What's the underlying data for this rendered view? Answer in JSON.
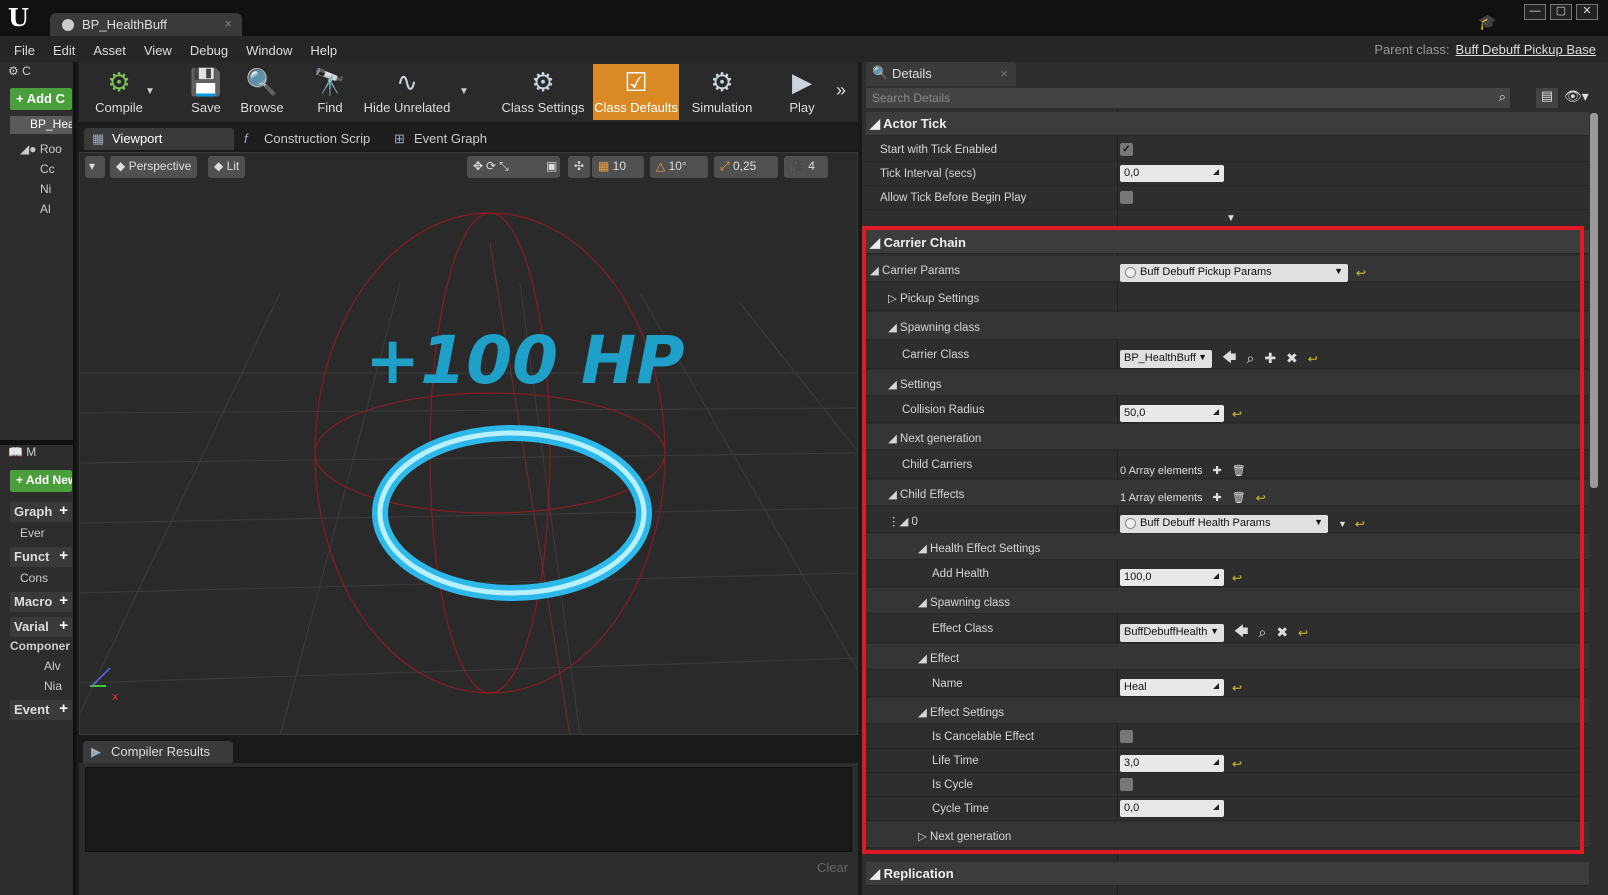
{
  "window": {
    "doc_tab": "BP_HealthBuff",
    "parent_class_label": "Parent class:",
    "parent_class_value": "Buff Debuff Pickup Base"
  },
  "menu": [
    "File",
    "Edit",
    "Asset",
    "View",
    "Debug",
    "Window",
    "Help"
  ],
  "left_panel": {
    "components_tab": "C",
    "add_component": "+ Add C",
    "root_item": "BP_Hea",
    "tree": [
      "Roo",
      "Cc",
      "Ni",
      "Al"
    ],
    "my_blueprint_tab": "M",
    "add_new": "+ Add New",
    "sections": [
      "Graph",
      "Funct",
      "Macro",
      "Varial",
      "Componer",
      "Event"
    ],
    "items": [
      "Ever",
      "Cons",
      "Alv",
      "Nia"
    ]
  },
  "toolbar": {
    "compile": "Compile",
    "save": "Save",
    "browse": "Browse",
    "find": "Find",
    "hide_unrelated": "Hide Unrelated",
    "class_settings": "Class Settings",
    "class_defaults": "Class Defaults",
    "simulation": "Simulation",
    "play": "Play"
  },
  "tabs": {
    "viewport": "Viewport",
    "construction": "Construction Scrip",
    "event_graph": "Event Graph"
  },
  "viewport": {
    "perspective": "Perspective",
    "lit": "Lit",
    "grid_snap": "10",
    "rot_snap": "10°",
    "scale_snap": "0,25",
    "cam_speed": "4",
    "hp_text": "+100 HP"
  },
  "compiler": {
    "tab": "Compiler Results",
    "clear": "Clear"
  },
  "details": {
    "tab": "Details",
    "search_placeholder": "Search Details",
    "actor_tick": "Actor Tick",
    "start_tick": "Start with Tick Enabled",
    "tick_interval": "Tick Interval (secs)",
    "tick_interval_val": "0,0",
    "allow_tick": "Allow Tick Before Begin Play",
    "carrier_chain": "Carrier Chain",
    "carrier_params": "Carrier Params",
    "carrier_params_val": "Buff Debuff Pickup Params",
    "pickup_settings": "Pickup Settings",
    "spawning_class": "Spawning class",
    "carrier_class": "Carrier Class",
    "carrier_class_val": "BP_HealthBuff",
    "settings": "Settings",
    "collision_radius": "Collision Radius",
    "collision_radius_val": "50,0",
    "next_gen": "Next generation",
    "child_carriers": "Child Carriers",
    "child_carriers_val": "0 Array elements",
    "child_effects": "Child Effects",
    "child_effects_val": "1 Array elements",
    "index0": "0",
    "index0_val": "Buff Debuff Health Params",
    "health_effect_settings": "Health Effect Settings",
    "add_health": "Add Health",
    "add_health_val": "100,0",
    "spawning_class2": "Spawning class",
    "effect_class": "Effect Class",
    "effect_class_val": "BuffDebuffHealth",
    "effect": "Effect",
    "name": "Name",
    "name_val": "Heal",
    "effect_settings": "Effect Settings",
    "is_cancelable": "Is Cancelable Effect",
    "life_time": "Life Time",
    "life_time_val": "3,0",
    "is_cycle": "Is Cycle",
    "cycle_time": "Cycle Time",
    "cycle_time_val": "0,0",
    "next_gen2": "Next generation",
    "replication": "Replication"
  },
  "colors": {
    "accent_orange": "#d98a24",
    "highlight_red": "#e01a22",
    "add_green": "#4b9e3c",
    "hp_cyan": "#1fa0c8"
  }
}
